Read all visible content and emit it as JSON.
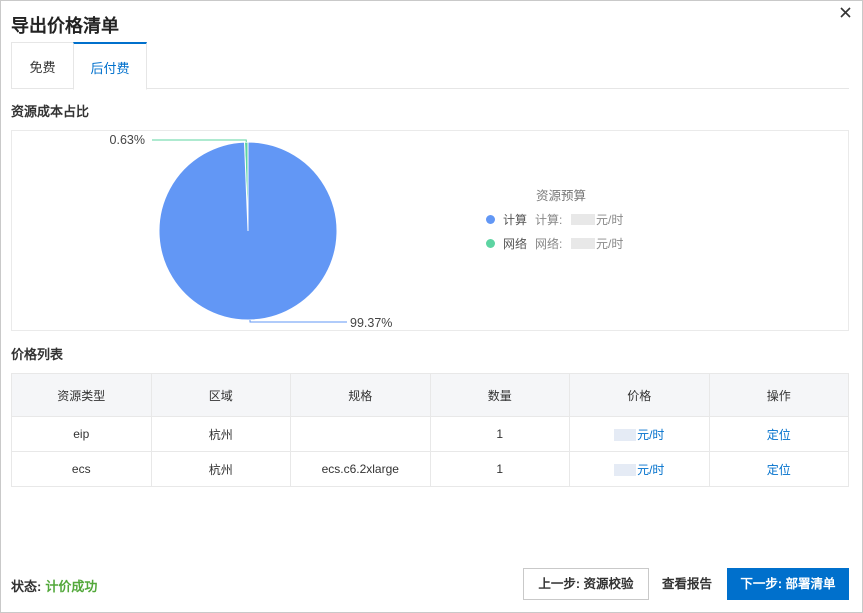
{
  "dialog": {
    "title": "导出价格清单"
  },
  "tabs": [
    {
      "label": "免费"
    },
    {
      "label": "后付费"
    }
  ],
  "sections": {
    "cost_ratio": "资源成本占比",
    "price_list": "价格列表"
  },
  "chart_data": {
    "type": "pie",
    "title": "",
    "legend_title": "资源预算",
    "legend_position": "right",
    "slices": [
      {
        "name": "计算",
        "label": "计算:",
        "unit": "元/时",
        "percent": 99.37,
        "display": "99.37%",
        "color": "#6297f5"
      },
      {
        "name": "网络",
        "label": "网络:",
        "unit": "元/时",
        "percent": 0.63,
        "display": "0.63%",
        "color": "#5dd4a2"
      }
    ]
  },
  "table": {
    "headers": [
      "资源类型",
      "区域",
      "规格",
      "数量",
      "价格",
      "操作"
    ],
    "rows": [
      {
        "type": "eip",
        "region": "杭州",
        "spec": "",
        "qty": "1",
        "price_unit": "元/时",
        "action": "定位"
      },
      {
        "type": "ecs",
        "region": "杭州",
        "spec": "ecs.c6.2xlarge",
        "qty": "1",
        "price_unit": "元/时",
        "action": "定位"
      }
    ]
  },
  "footer": {
    "status_label": "状态:",
    "status_value": "计价成功",
    "status_color": "#52a83a",
    "prev_button": "上一步: 资源校验",
    "report_button": "查看报告",
    "next_button": "下一步: 部署清单"
  },
  "icons": {
    "close": "close-icon"
  },
  "colors": {
    "accent": "#0070cc"
  }
}
